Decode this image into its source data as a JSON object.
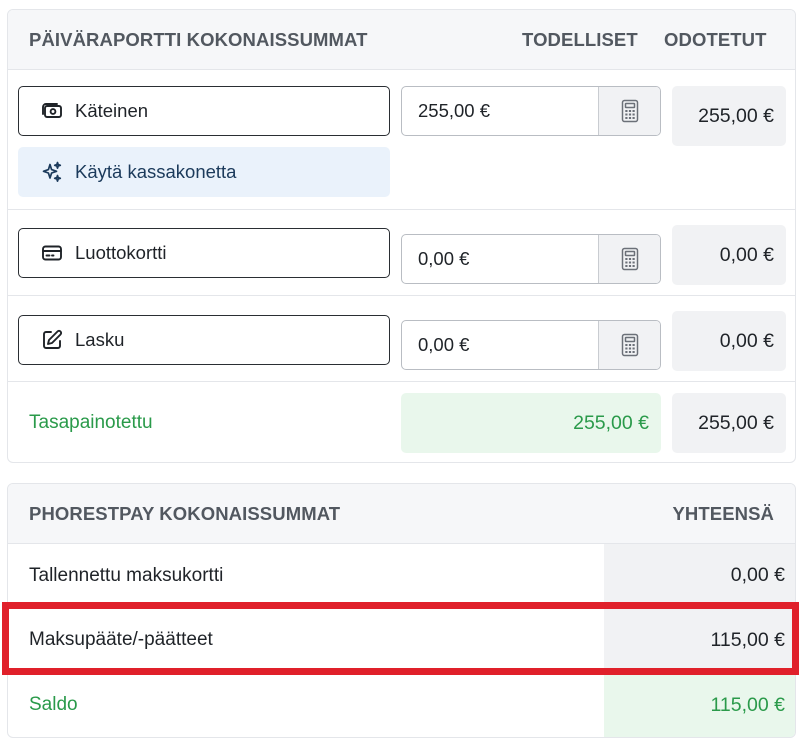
{
  "daily_report": {
    "title": "PÄIVÄRAPORTTI KOKONAISSUMMAT",
    "col_actual": "TODELLISET",
    "col_expected": "ODOTETUT",
    "rows": [
      {
        "method": "Käteinen",
        "icon": "cash-icon",
        "actual": "255,00 €",
        "expected": "255,00 €"
      },
      {
        "method": "Luottokortti",
        "icon": "credit-card-icon",
        "actual": "0,00 €",
        "expected": "0,00 €"
      },
      {
        "method": "Lasku",
        "icon": "edit-icon",
        "actual": "0,00 €",
        "expected": "0,00 €"
      }
    ],
    "use_register_label": "Käytä kassakonetta",
    "balanced": {
      "label": "Tasapainotettu",
      "actual": "255,00 €",
      "expected": "255,00 €"
    }
  },
  "phorestpay": {
    "title": "PHORESTPAY KOKONAISSUMMAT",
    "col_total": "YHTEENSÄ",
    "rows": [
      {
        "label": "Tallennettu maksukortti",
        "value": "0,00 €"
      },
      {
        "label": "Maksupääte/-päätteet",
        "value": "115,00 €"
      }
    ],
    "balance": {
      "label": "Saldo",
      "value": "115,00 €"
    }
  },
  "colors": {
    "positive_green": "#2a9a4a",
    "highlight_red": "#e0202a",
    "register_button_bg": "#eaf2fb"
  }
}
